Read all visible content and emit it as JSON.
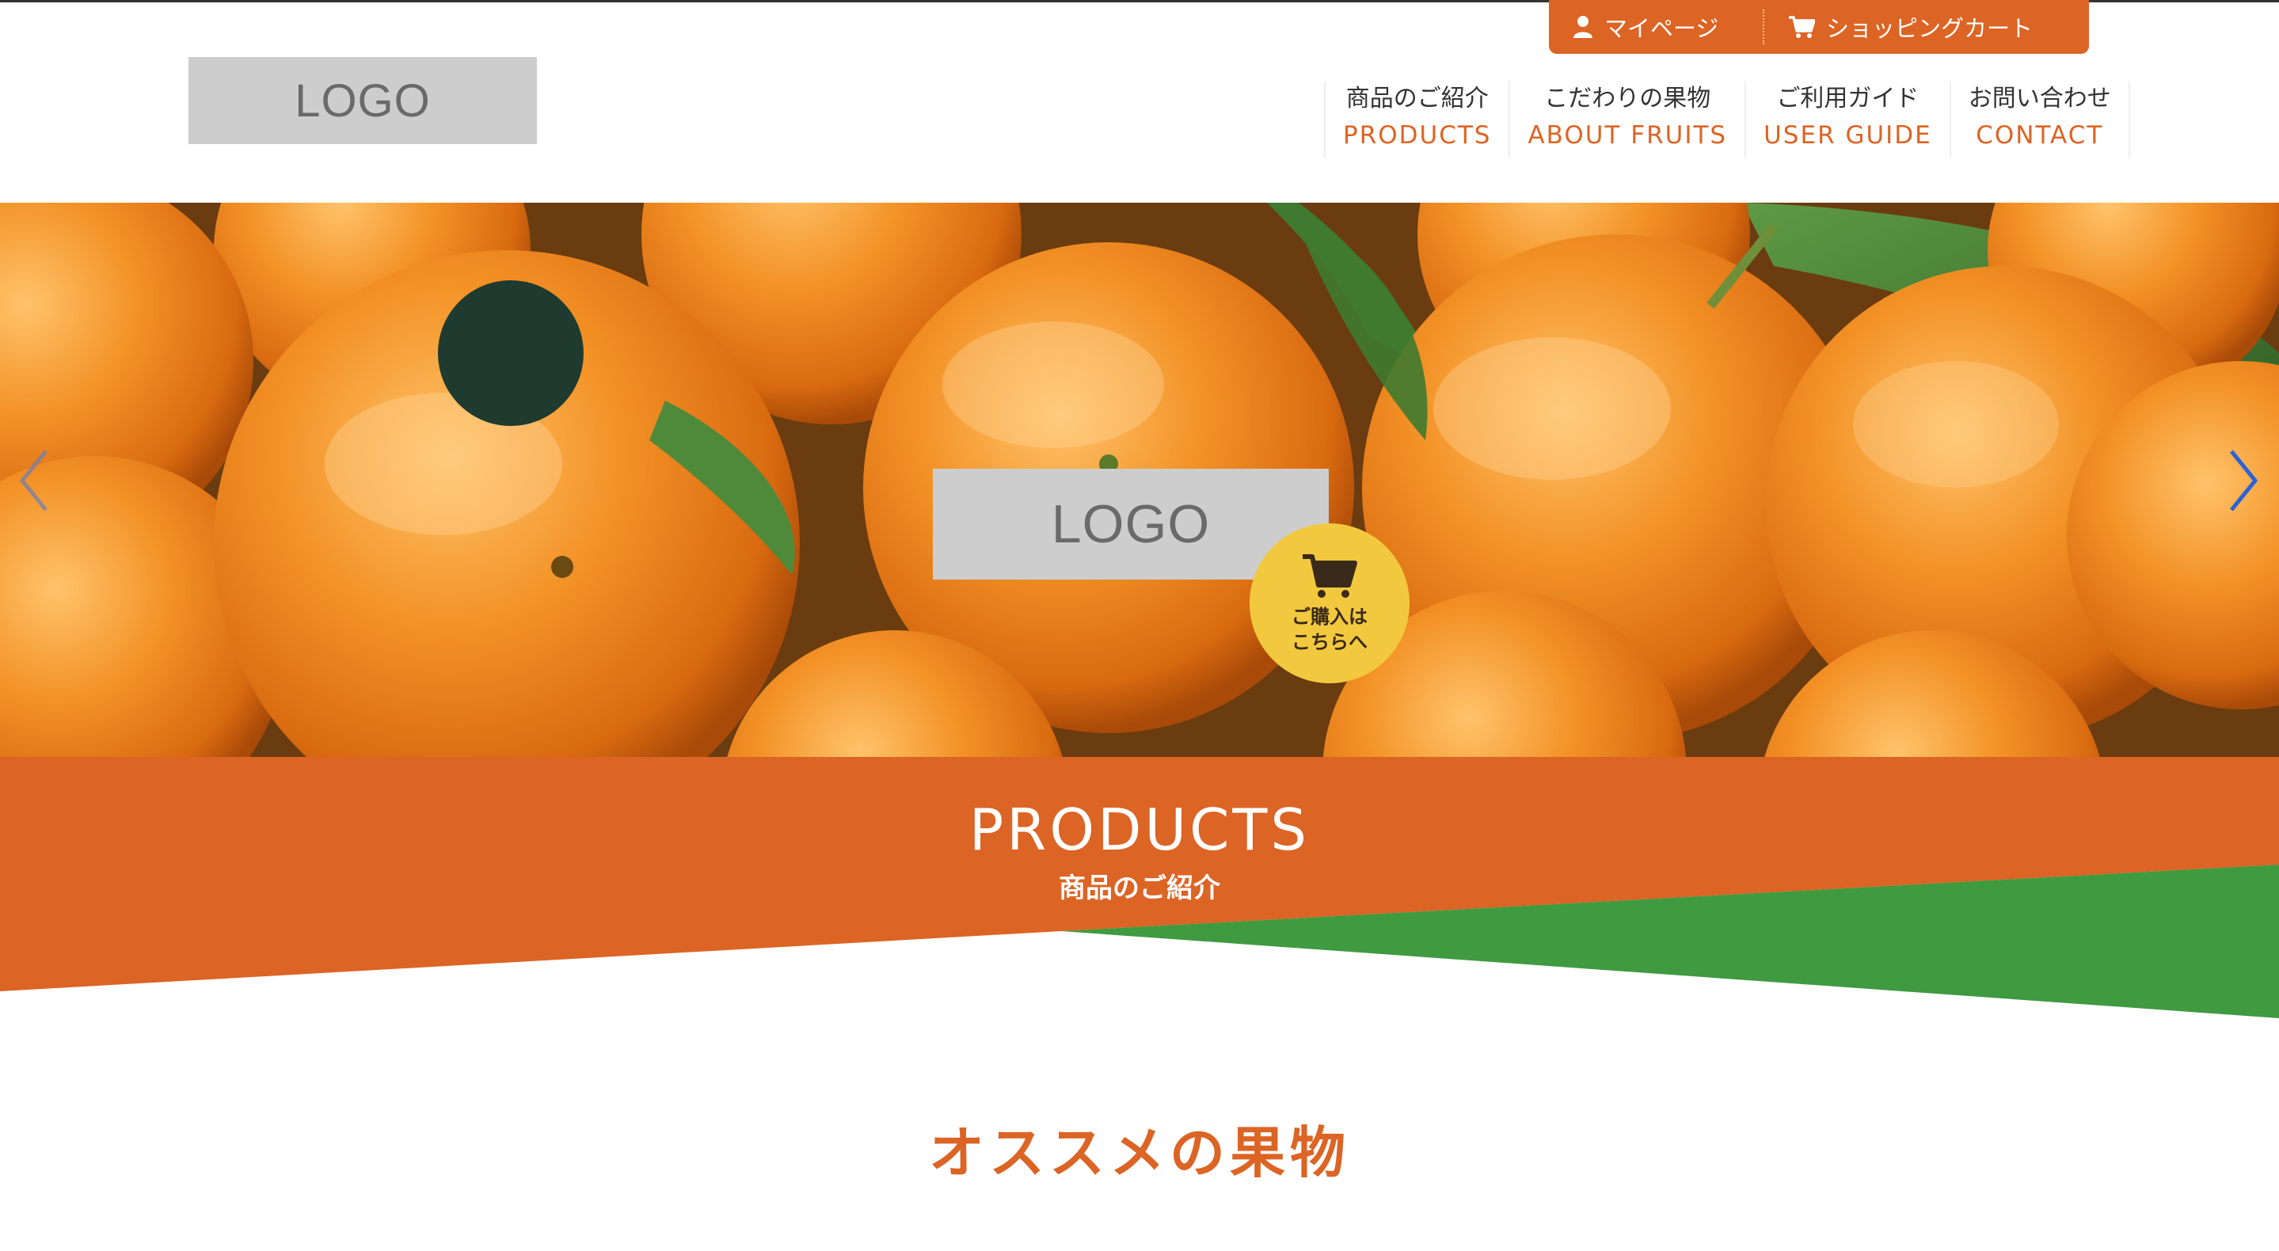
{
  "utility_bar": {
    "mypage_label": "マイページ",
    "cart_label": "ショッピングカート",
    "icons": [
      "user-icon",
      "cart-icon"
    ]
  },
  "header": {
    "logo_text": "LOGO",
    "nav": [
      {
        "ja": "商品のご紹介",
        "en": "PRODUCTS"
      },
      {
        "ja": "こだわりの果物",
        "en": "ABOUT FRUITS"
      },
      {
        "ja": "ご利用ガイド",
        "en": "USER GUIDE"
      },
      {
        "ja": "お問い合わせ",
        "en": "CONTACT"
      }
    ]
  },
  "hero": {
    "logo_text": "LOGO",
    "buy_button": {
      "line1": "ご購入は",
      "line2": "こちらへ",
      "icon": "cart-icon"
    },
    "prev_icon": "chevron-left-icon",
    "next_icon": "chevron-right-icon"
  },
  "banner": {
    "title": "PRODUCTS",
    "subtitle": "商品のご紹介"
  },
  "section": {
    "title": "オススメの果物"
  },
  "colors": {
    "accent_orange": "#dc6424",
    "accent_green": "#3f9a40",
    "buy_yellow": "#f2c93e",
    "logo_gray": "#cdcdcd"
  }
}
